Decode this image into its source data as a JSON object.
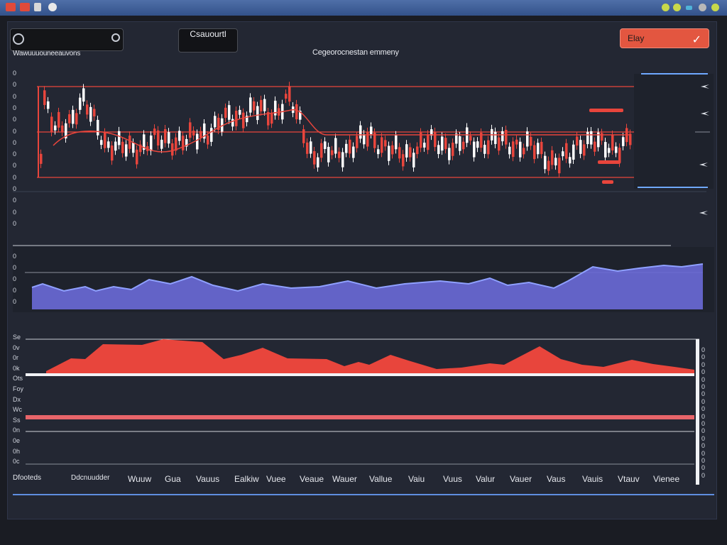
{
  "titlebar": {
    "left_icons": [
      "window-icon",
      "browser-icon",
      "document-icon",
      "refresh-icon"
    ],
    "right_controls": [
      "minimize-dot",
      "restore-dot",
      "info-dot",
      "maximize-dot",
      "close-dot"
    ],
    "colors": [
      "#c8d84a",
      "#c8d84a",
      "#4fb3d9",
      "#b8b8b8",
      "#c8d84a"
    ]
  },
  "toolbar": {
    "left_button_label": "",
    "center_button_label": "Csauourtl",
    "right_button_label": "Elay",
    "left_caption": "Wawuuuouneeauvons",
    "center_caption": "Cegeorocnestan emmeny"
  },
  "main_chart": {
    "left_ticks": [
      "0",
      "0",
      "0",
      "0",
      "0",
      "0",
      "0",
      "0",
      "0",
      "0",
      "0",
      "0",
      "0",
      "0"
    ],
    "colors": {
      "candle_up": "#ffffff",
      "candle_down": "#e8453c",
      "ma": "#e8453c",
      "grid": "#3a4050"
    }
  },
  "mid_chart": {
    "left_ticks": [
      "0",
      "0",
      "0",
      "0",
      "0"
    ],
    "fill_color": "#6a6ad8",
    "line_color": "#8fa0ff"
  },
  "lower_chart": {
    "left_ticks": [
      "Se",
      "0v",
      "0r",
      "0k",
      "Ots",
      "Foy",
      "Dx",
      "Wc",
      "Ss",
      "0n",
      "0e",
      "0h",
      "0c"
    ],
    "right_ticks": [
      "0",
      "0",
      "0",
      "0",
      "0",
      "0",
      "0",
      "0",
      "0",
      "0",
      "0",
      "0",
      "0",
      "0",
      "0",
      "0",
      "0",
      "0"
    ],
    "fill_color": "#e8453c"
  },
  "x_axis_labels": [
    "Dfooteds",
    "Ddcnuudder",
    "Wuuw",
    "Gua",
    "Vauus",
    "Ealkiw",
    "Vuee",
    "Veaue",
    "Wauer",
    "Vallue",
    "Vaiu",
    "Vuus",
    "Valur",
    "Vauer",
    "Vaus",
    "Vauis",
    "Vtauv",
    "Vienee"
  ]
}
